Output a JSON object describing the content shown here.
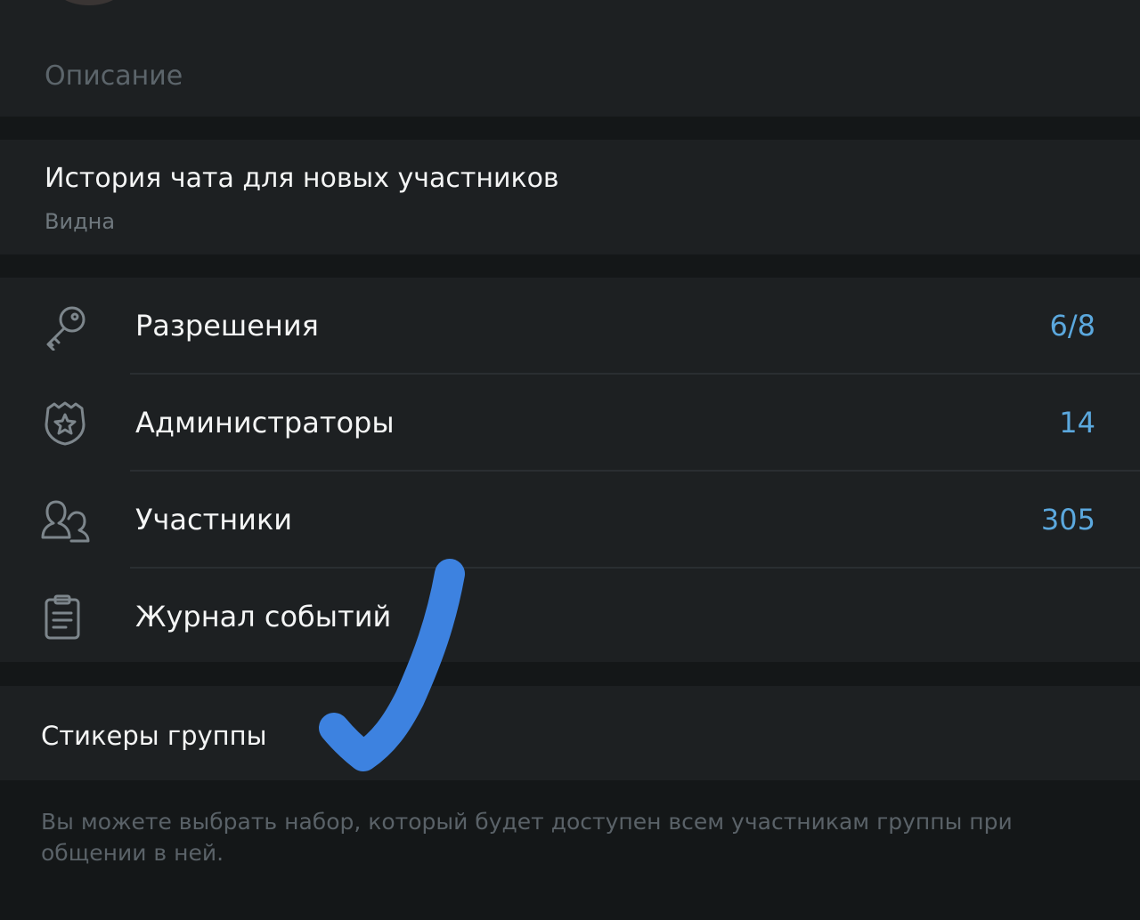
{
  "profile": {
    "description_placeholder": "Описание"
  },
  "history": {
    "title": "История чата для новых участников",
    "value": "Видна"
  },
  "menu": {
    "items": [
      {
        "label": "Разрешения",
        "value": "6/8",
        "icon": "key-icon"
      },
      {
        "label": "Администраторы",
        "value": "14",
        "icon": "shield-star-icon"
      },
      {
        "label": "Участники",
        "value": "305",
        "icon": "people-icon"
      },
      {
        "label": "Журнал событий",
        "value": "",
        "icon": "clipboard-list-icon"
      }
    ]
  },
  "stickers": {
    "label": "Стикеры группы",
    "note": "Вы можете выбрать набор, который будет доступен всем участникам группы при общении в ней."
  },
  "colors": {
    "background": "#141718",
    "card": "#1d2022",
    "accent": "#5ba8de",
    "annotation": "#3d82e0"
  },
  "annotation": {
    "icon": "checkmark-icon"
  }
}
